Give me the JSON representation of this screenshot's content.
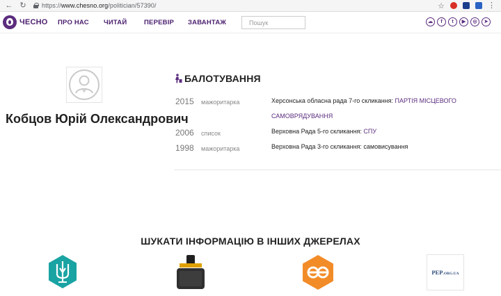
{
  "browser": {
    "url_scheme": "https://",
    "url_host": "www.chesno.org",
    "url_path": "/politician/57390/",
    "back_icon": "back-arrow-icon",
    "reload_icon": "reload-icon",
    "star_icon": "star-icon"
  },
  "header": {
    "logo_text": "ЧЕСНО",
    "nav": [
      "ПРО НАС",
      "ЧИТАЙ",
      "ПЕРЕВІР",
      "ЗАВАНТАЖ"
    ],
    "search_placeholder": "Пошук",
    "socials": [
      {
        "icon": "soundcloud-icon",
        "glyph": "☁"
      },
      {
        "icon": "facebook-icon",
        "glyph": "f"
      },
      {
        "icon": "twitter-icon",
        "glyph": "t"
      },
      {
        "icon": "youtube-icon",
        "glyph": "▶"
      },
      {
        "icon": "instagram-icon",
        "glyph": "◎"
      },
      {
        "icon": "telegram-icon",
        "glyph": "➤"
      }
    ],
    "brand_color": "#5b2c7e"
  },
  "profile": {
    "name": "Кобцов Юрій Олександрович",
    "avatar_icon": "user-placeholder-icon"
  },
  "ballot": {
    "title": "БАЛОТУВАННЯ",
    "icon": "voting-person-icon",
    "entries": [
      {
        "year": "2015",
        "kind": "мажоритарка",
        "desc": "Херсонська обласна рада 7-го скликання: ",
        "link": "ПАРТІЯ МІСЦЕВОГО САМОВРЯДУВАННЯ"
      },
      {
        "year": "2006",
        "kind": "список",
        "desc": "Верховна Рада 5-го скликання: ",
        "link": "СПУ"
      },
      {
        "year": "1998",
        "kind": "мажоритарка",
        "desc": "Верховна Рада 3-го скликання: самовисування",
        "link": ""
      }
    ]
  },
  "sources": {
    "title": "ШУКАТИ ІНФОРМАЦІЮ В ІНШИХ ДЖЕРЕЛАХ",
    "items": [
      {
        "icon": "trident-emblem-icon"
      },
      {
        "icon": "briefcase-icon"
      },
      {
        "icon": "infinity-badge-icon"
      },
      {
        "icon": "pep-logo",
        "text_main": "PEP",
        "text_small": ".ORG.UA"
      }
    ]
  }
}
